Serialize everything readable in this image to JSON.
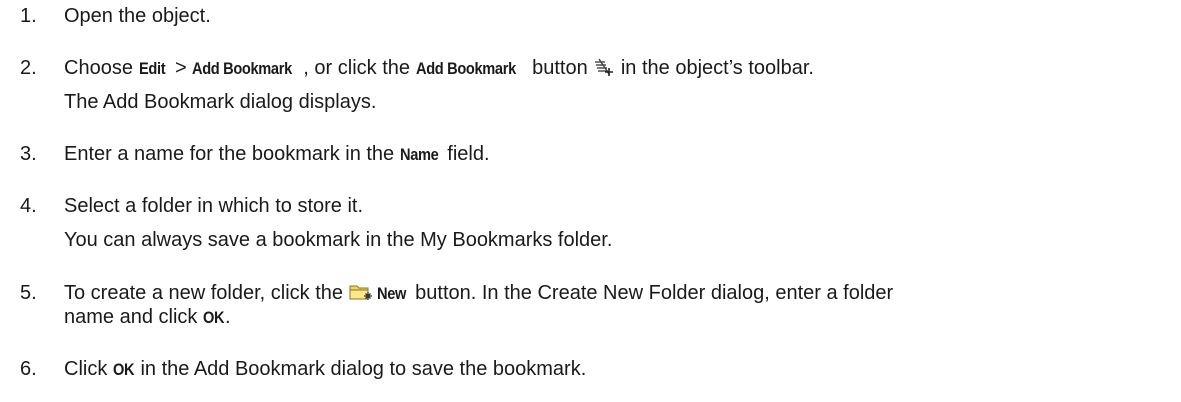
{
  "steps": [
    {
      "num": "1.",
      "text": "Open the object."
    },
    {
      "num": "2.",
      "t1": "Choose ",
      "b1": "Edit",
      "t2": " > ",
      "b2": "Add Bookmark",
      "t3": ", or click the ",
      "b3": "Add Bookmark",
      "t4": " button ",
      "t5": " in the object’s toolbar.",
      "icon": "add-bookmark-icon",
      "note": "The Add Bookmark dialog displays."
    },
    {
      "num": "3.",
      "t1": "Enter a name for the bookmark in the ",
      "b1": "Name",
      "t2": " field."
    },
    {
      "num": "4.",
      "text": "Select a folder in which to store it.",
      "note": "You can always save a bookmark in the My Bookmarks folder."
    },
    {
      "num": "5.",
      "t1": "To create a new folder, click the ",
      "icon": "new-folder-icon",
      "b1": "New",
      "t2": " button. In the Create New Folder dialog, enter a folder",
      "line2_t1": "name and click ",
      "line2_b1": "OK",
      "line2_t2": "."
    },
    {
      "num": "6.",
      "t1": "Click ",
      "b1": "OK",
      "t2": " in the Add Bookmark dialog to save the bookmark."
    }
  ]
}
